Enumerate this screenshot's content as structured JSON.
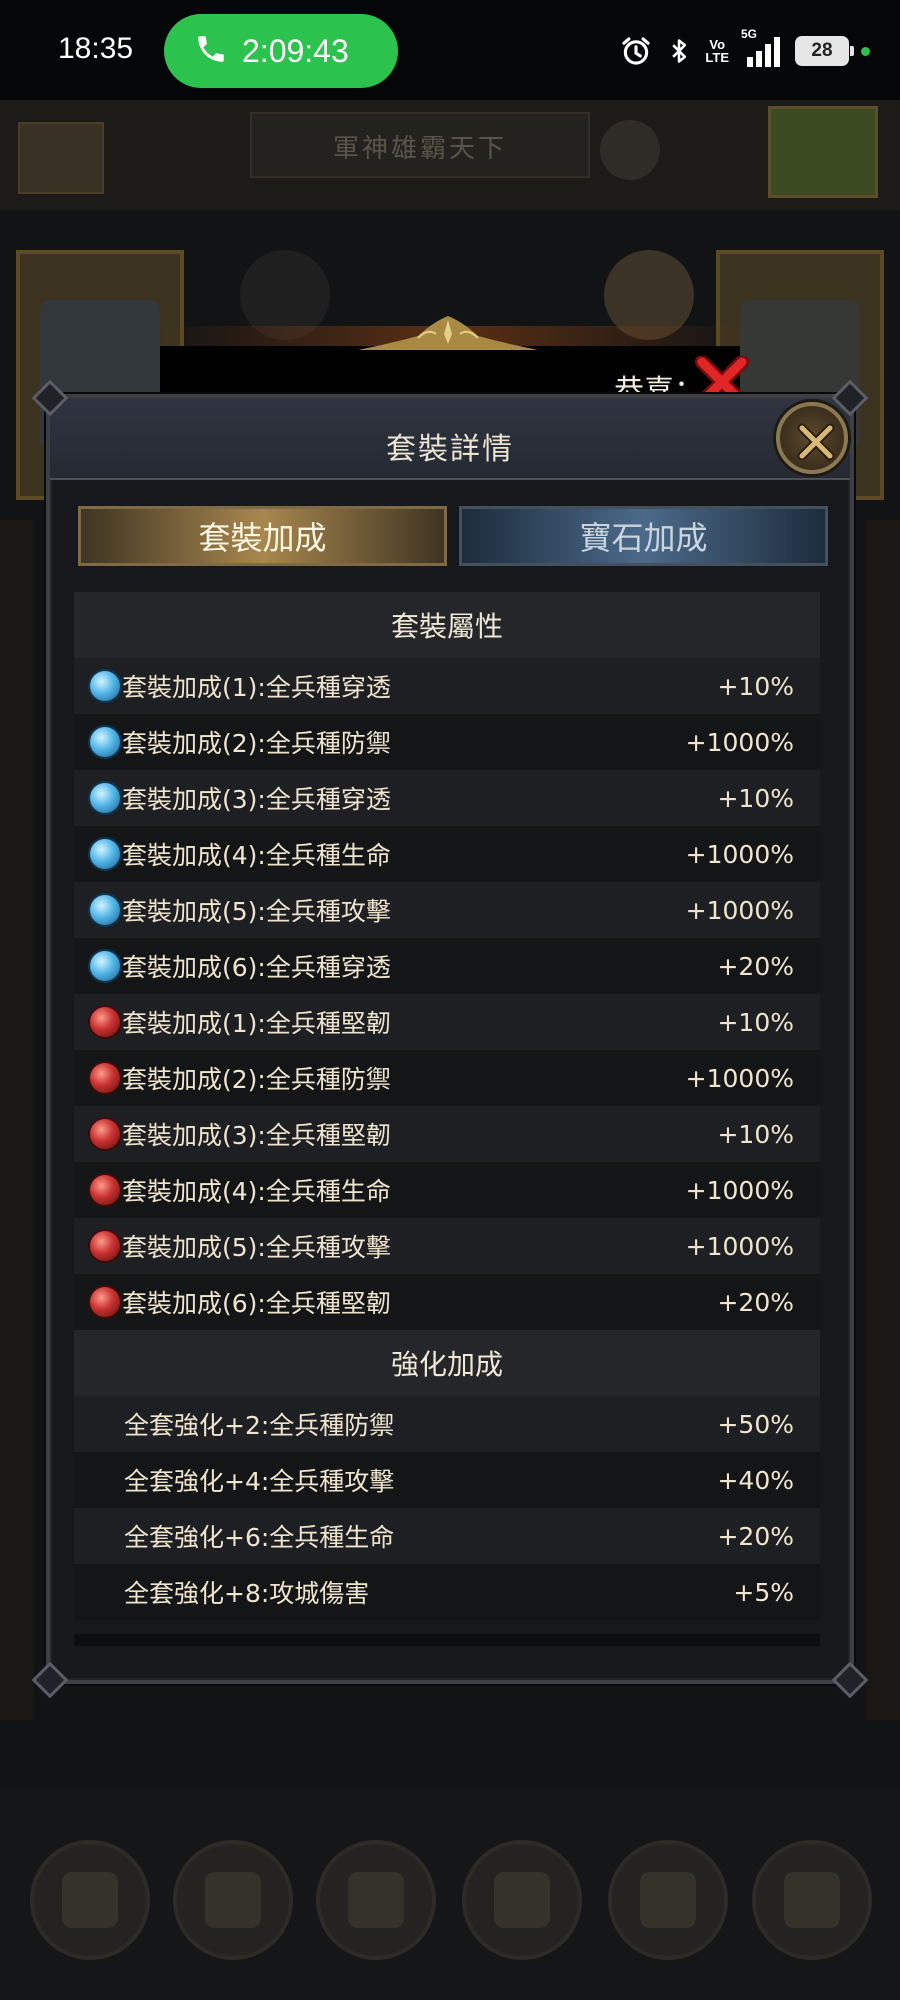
{
  "status_bar": {
    "time": "18:35",
    "call_duration": "2:09:43",
    "volte_top": "Vo",
    "volte_bottom": "LTE",
    "network": "5G",
    "battery": "28",
    "icons": [
      "phone-icon",
      "alarm-icon",
      "bluetooth-icon",
      "volte-icon",
      "signal-icon",
      "battery-icon"
    ]
  },
  "background": {
    "title": "軍神雄霸天下"
  },
  "banner": {
    "congrats_label": "恭喜："
  },
  "modal": {
    "title": "套裝詳情",
    "tabs": [
      {
        "label": "套裝加成",
        "active": true
      },
      {
        "label": "寶石加成",
        "active": false
      }
    ],
    "set_section_title": "套裝屬性",
    "set_rows": [
      {
        "gem": "blue",
        "label": "套裝加成(1):全兵種穿透",
        "value": "+10%"
      },
      {
        "gem": "blue",
        "label": "套裝加成(2):全兵種防禦",
        "value": "+1000%"
      },
      {
        "gem": "blue",
        "label": "套裝加成(3):全兵種穿透",
        "value": "+10%"
      },
      {
        "gem": "blue",
        "label": "套裝加成(4):全兵種生命",
        "value": "+1000%"
      },
      {
        "gem": "blue",
        "label": "套裝加成(5):全兵種攻擊",
        "value": "+1000%"
      },
      {
        "gem": "blue",
        "label": "套裝加成(6):全兵種穿透",
        "value": "+20%"
      },
      {
        "gem": "red",
        "label": "套裝加成(1):全兵種堅韌",
        "value": "+10%"
      },
      {
        "gem": "red",
        "label": "套裝加成(2):全兵種防禦",
        "value": "+1000%"
      },
      {
        "gem": "red",
        "label": "套裝加成(3):全兵種堅韌",
        "value": "+10%"
      },
      {
        "gem": "red",
        "label": "套裝加成(4):全兵種生命",
        "value": "+1000%"
      },
      {
        "gem": "red",
        "label": "套裝加成(5):全兵種攻擊",
        "value": "+1000%"
      },
      {
        "gem": "red",
        "label": "套裝加成(6):全兵種堅韌",
        "value": "+20%"
      }
    ],
    "enhance_section_title": "強化加成",
    "enhance_rows": [
      {
        "label": "全套強化+2:全兵種防禦",
        "value": "+50%"
      },
      {
        "label": "全套強化+4:全兵種攻擊",
        "value": "+40%"
      },
      {
        "label": "全套強化+6:全兵種生命",
        "value": "+20%"
      },
      {
        "label": "全套強化+8:攻城傷害",
        "value": "+5%"
      }
    ]
  },
  "colors": {
    "tab_active": "#a8874e",
    "tab_inactive": "#4b6a8a",
    "gem_blue": "#52b6e8",
    "gem_red": "#c63030",
    "call_green": "#2bc34e"
  }
}
